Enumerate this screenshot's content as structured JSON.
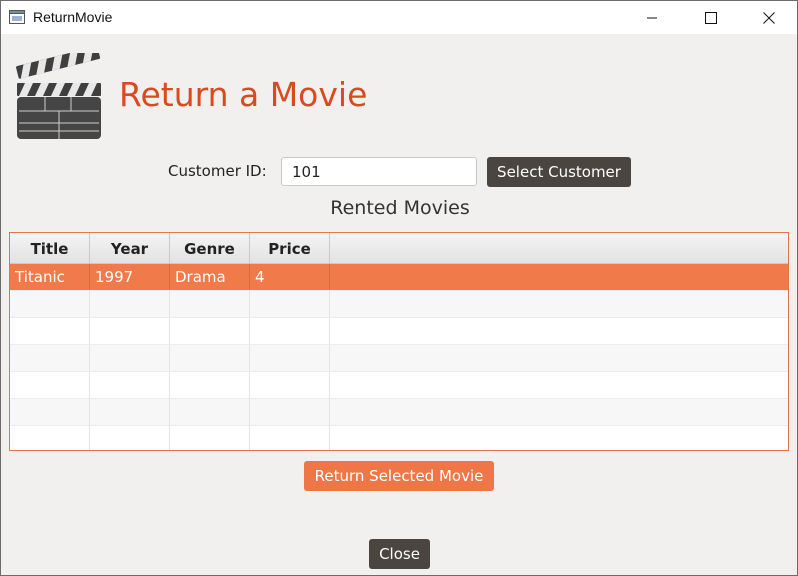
{
  "window": {
    "title": "ReturnMovie"
  },
  "header": {
    "title": "Return a Movie",
    "icon": "clapperboard-icon"
  },
  "customer": {
    "label": "Customer ID:",
    "value": "101",
    "select_button": "Select Customer"
  },
  "rented": {
    "title": "Rented Movies",
    "columns": [
      "Title",
      "Year",
      "Genre",
      "Price"
    ],
    "rows": [
      {
        "title": "Titanic",
        "year": "1997",
        "genre": "Drama",
        "price": "4",
        "selected": true
      }
    ]
  },
  "actions": {
    "return_button": "Return Selected Movie",
    "close_button": "Close"
  },
  "colors": {
    "accent": "#ef7747",
    "title_accent": "#d64b1f",
    "dark_button": "#4a463f"
  }
}
